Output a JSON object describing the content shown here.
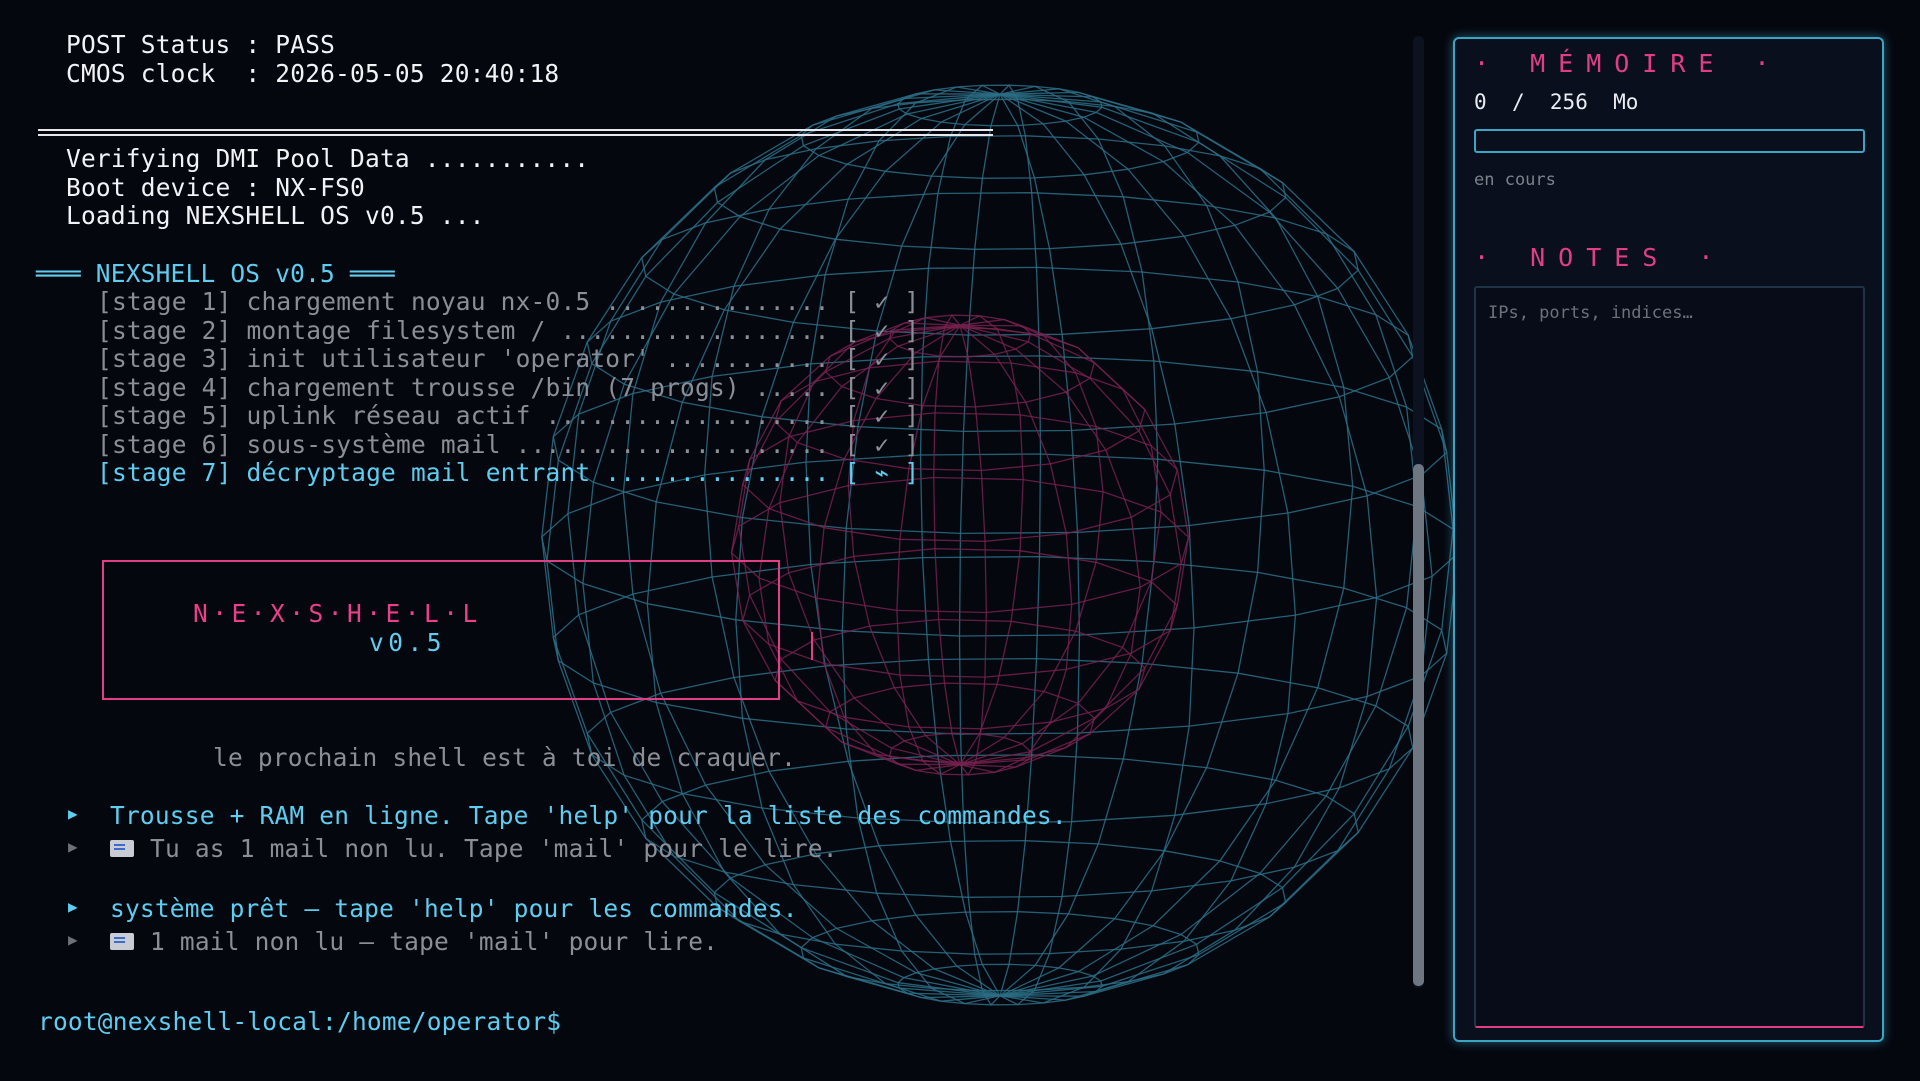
{
  "post": {
    "status_line": "POST Status : PASS",
    "clock_line": "CMOS clock  : 2026-05-05 20:40:18"
  },
  "boot": {
    "lines": [
      "Verifying DMI Pool Data ...........",
      "Boot device : NX-FS0",
      "Loading NEXSHELL OS v0.5 ..."
    ]
  },
  "os_header": "═══ NEXSHELL OS v0.5 ═══",
  "stages": [
    "[stage 1] chargement noyau nx-0.5 ............... [ ✓ ]",
    "[stage 2] montage filesystem / .................. [ ✓ ]",
    "[stage 3] init utilisateur 'operator' ........... [ ✓ ]",
    "[stage 4] chargement trousse /bin (7 progs) ..... [ ✓ ]",
    "[stage 5] uplink réseau actif ................... [ ✓ ]",
    "[stage 6] sous-système mail ..................... [ ✓ ]",
    "[stage 7] décryptage mail entrant ............... [ ⌁ ]"
  ],
  "banner": {
    "title": "N·E·X·S·H·E·L·L",
    "version": "v0.5"
  },
  "tagline": "le prochain shell est à toi de craquer.",
  "messages": [
    {
      "kind": "primary",
      "text": "Trousse + RAM en ligne. Tape 'help' pour la liste des commandes."
    },
    {
      "kind": "mail",
      "text": "Tu as 1 mail non lu. Tape 'mail' pour le lire."
    },
    {
      "kind": "primary",
      "text": "système prêt — tape 'help' pour les commandes."
    },
    {
      "kind": "mail",
      "text": "1 mail non lu — tape 'mail' pour lire."
    }
  ],
  "prompt": "root@nexshell-local:/home/operator$",
  "panel": {
    "memory_heading": "· MÉMOIRE ·",
    "memory_used": "0",
    "memory_separator": "/",
    "memory_total": "256",
    "memory_unit": "Mo",
    "memory_fraction": 0,
    "memory_status": "en cours",
    "notes_heading": "· NOTES ·",
    "notes_placeholder": "IPs, ports, indices…"
  },
  "colors": {
    "background": "#05070f",
    "cyan": "#5ecdf0",
    "magenta": "#e03f86",
    "wireframe_outer": "#2b6f86",
    "wireframe_inner": "#7a2250"
  },
  "icons": [
    "arrow-right-icon",
    "mail-icon"
  ]
}
